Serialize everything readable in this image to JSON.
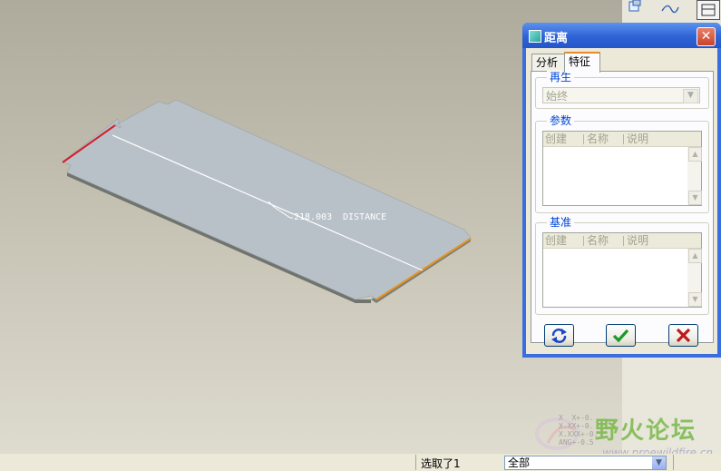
{
  "model": {
    "dimension_value": "218.003",
    "dimension_label": "DISTANCE"
  },
  "dialog": {
    "title": "距离",
    "close_glyph": "✕",
    "tabs": [
      {
        "label": "分析",
        "active": false
      },
      {
        "label": "特征",
        "active": true
      }
    ],
    "regen": {
      "label": "再生",
      "selected": "始终"
    },
    "params": {
      "label": "参数",
      "columns": [
        "创建",
        "名称",
        "说明"
      ]
    },
    "datum": {
      "label": "基准",
      "columns": [
        "创建",
        "名称",
        "说明"
      ]
    },
    "buttons": {
      "repeat_icon": "repeat-icon",
      "ok_icon": "checkmark-icon",
      "cancel_icon": "x-icon"
    }
  },
  "status": {
    "message": "选取了1",
    "filter": "全部"
  },
  "watermark": {
    "text": "野火论坛",
    "url": "www.proewildfire.cn"
  },
  "coords": {
    "lines": [
      "X  X+-0.",
      "X.XX+-0.",
      "X.XXX+-0.",
      "ANG+-0.5"
    ]
  },
  "colors": {
    "titlebar": "#2f63d6",
    "red_edge": "#d4202a",
    "orange_edge": "#e8921c",
    "ok_green": "#1c9a2a",
    "cancel_red": "#c01818"
  }
}
